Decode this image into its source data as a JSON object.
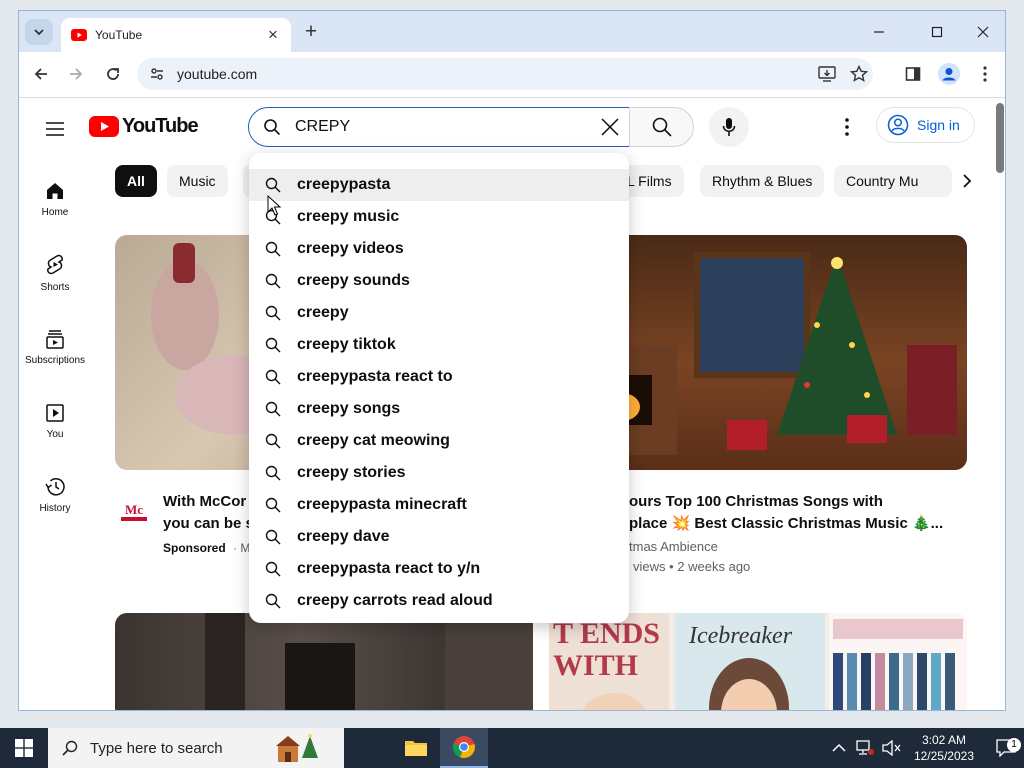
{
  "browser": {
    "tab_title": "YouTube",
    "url": "youtube.com"
  },
  "youtube": {
    "logo_text": "YouTube",
    "search_query": "CREPY",
    "sign_in_label": "Sign in",
    "sidebar": [
      {
        "label": "Home",
        "icon": "home-icon"
      },
      {
        "label": "Shorts",
        "icon": "shorts-icon"
      },
      {
        "label": "Subscriptions",
        "icon": "subscriptions-icon"
      },
      {
        "label": "You",
        "icon": "you-icon"
      },
      {
        "label": "History",
        "icon": "history-icon"
      }
    ],
    "chips": [
      "All",
      "Music",
      "L Films",
      "Rhythm & Blues",
      "Country Mu"
    ],
    "suggestions": [
      "creepypasta",
      "creepy music",
      "creepy videos",
      "creepy sounds",
      "creepy",
      "creepy tiktok",
      "creepypasta react to",
      "creepy songs",
      "creepy cat meowing",
      "creepy stories",
      "creepypasta minecraft",
      "creepy dave",
      "creepypasta react to y/n",
      "creepy carrots read aloud"
    ],
    "videos": [
      {
        "title_line1": "With McCor",
        "title_line2": "you can be s",
        "sponsored": "Sponsored",
        "channel_fragment": "· M"
      },
      {
        "title_line1": "ours Top 100 Christmas Songs with",
        "title_line2": "place 💥 Best Classic Christmas Music 🎄...",
        "channel": "tmas Ambience",
        "stats": "views • 2 weeks ago"
      }
    ],
    "colors": {
      "brand_red": "#ff0000",
      "link_blue": "#065fd4",
      "search_border": "#1c62b9"
    }
  },
  "taskbar": {
    "search_placeholder": "Type here to search",
    "time": "3:02 AM",
    "date": "12/25/2023",
    "notification_count": "1"
  }
}
